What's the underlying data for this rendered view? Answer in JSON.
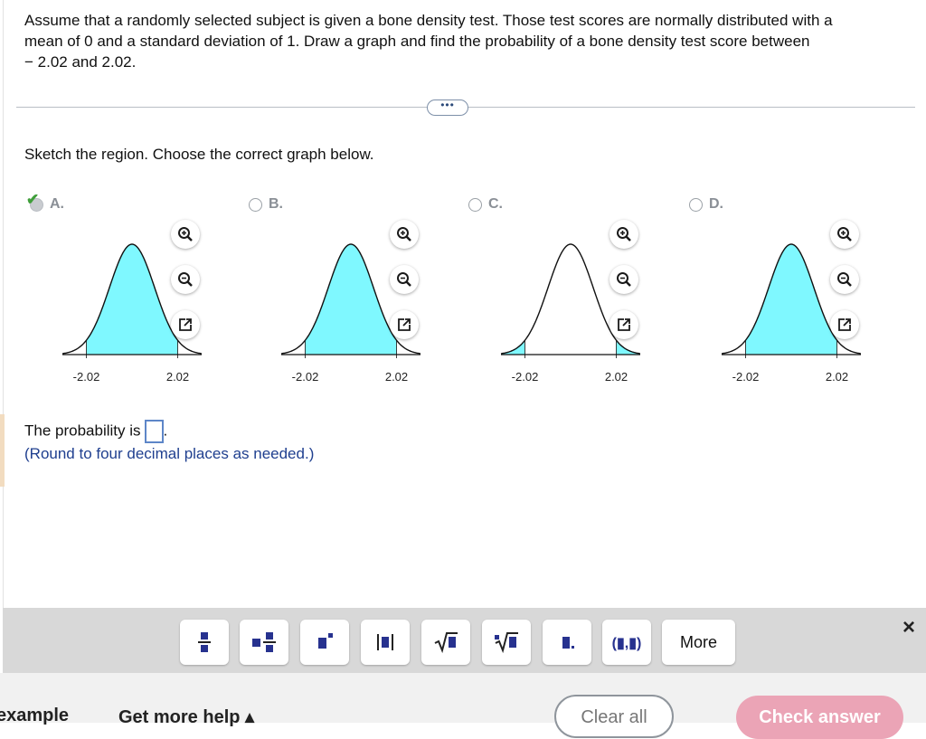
{
  "question": {
    "text_line1": "Assume that a randomly selected subject is given a bone density test. Those test scores are normally distributed with a",
    "text_line2": "mean of 0 and a standard deviation of 1. Draw a graph and find the probability of a bone density test score between",
    "text_line3": "− 2.02 and 2.02."
  },
  "more_indicator": "•••",
  "instruction": "Sketch the region. Choose the correct graph below.",
  "options": [
    {
      "label": "A.",
      "selected": true,
      "left_tick": "-2.02",
      "right_tick": "2.02",
      "shading": "between"
    },
    {
      "label": "B.",
      "selected": false,
      "left_tick": "-2.02",
      "right_tick": "2.02",
      "shading": "between"
    },
    {
      "label": "C.",
      "selected": false,
      "left_tick": "-2.02",
      "right_tick": "2.02",
      "shading": "tails"
    },
    {
      "label": "D.",
      "selected": false,
      "left_tick": "-2.02",
      "right_tick": "2.02",
      "shading": "between"
    }
  ],
  "icons": {
    "zoom_in": "zoom-in-icon",
    "zoom_out": "zoom-out-icon",
    "popout": "popout-icon",
    "check": "checkmark-icon",
    "close": "close-icon"
  },
  "probability": {
    "prefix": "The probability is",
    "suffix": ".",
    "note": "(Round to four decimal places as needed.)"
  },
  "toolbar": {
    "buttons": [
      "fraction",
      "mixed-number",
      "exponent",
      "absolute-value",
      "square-root",
      "nth-root",
      "decimal",
      "interval"
    ],
    "more_label": "More",
    "close": "×"
  },
  "footer": {
    "example": "example",
    "help": "Get more help ▴",
    "clear": "Clear all",
    "check": "Check answer"
  },
  "colors": {
    "shade": "#7ff8ff",
    "accent": "#3f9e3a",
    "check_button": "#eba4b6"
  }
}
